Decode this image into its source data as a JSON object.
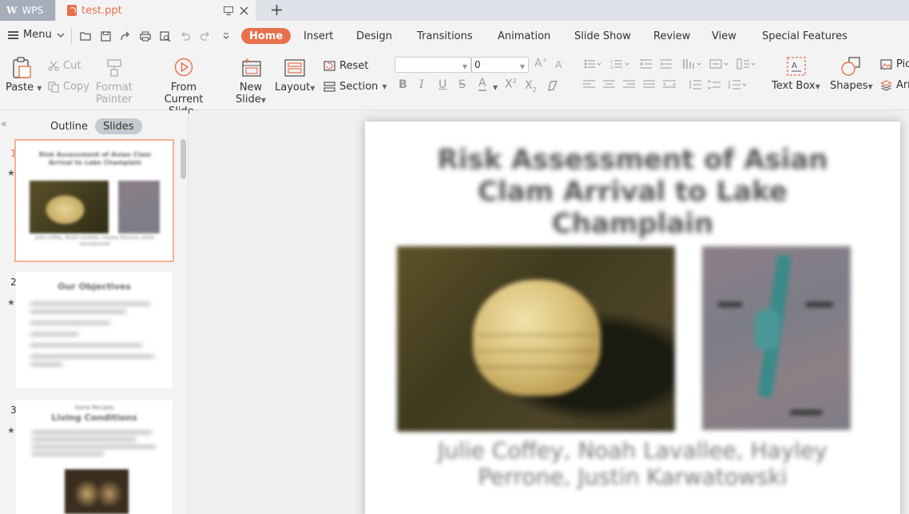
{
  "tabs": {
    "app": "WPS",
    "document": "test.ppt"
  },
  "menu": {
    "menu_label": "Menu",
    "tabs": [
      "Home",
      "Insert",
      "Design",
      "Transitions",
      "Animation",
      "Slide Show",
      "Review",
      "View",
      "Special Features"
    ],
    "active_tab": "Home"
  },
  "ribbon": {
    "paste": "Paste",
    "cut": "Cut",
    "copy": "Copy",
    "format_painter": [
      "Format",
      "Painter"
    ],
    "from_current_slide": [
      "From Current",
      "Slide"
    ],
    "new_slide": [
      "New",
      "Slide"
    ],
    "layout": "Layout",
    "reset": "Reset",
    "section": "Section",
    "font_name": "",
    "font_size": "0",
    "text_box": "Text Box",
    "shapes": "Shapes",
    "picture": "Pic",
    "arrange": "Arr"
  },
  "panel": {
    "outline_tab": "Outline",
    "slides_tab": "Slides",
    "active_tab": "Slides",
    "slide_numbers": [
      "1",
      "2",
      "3"
    ],
    "slide2_title": "Our Objectives",
    "slide3_title": [
      "Some Recipes",
      "Living Conditions"
    ]
  },
  "slide": {
    "title": "Risk Assessment of Asian Clam Arrival to Lake Champlain",
    "authors": "Julie Coffey, Noah Lavallee, Hayley Perrone, Justin Karwatowski"
  },
  "colors": {
    "accent": "#e8704b",
    "tab_bar": "#dfe2e8",
    "background": "#f3f3f3"
  }
}
